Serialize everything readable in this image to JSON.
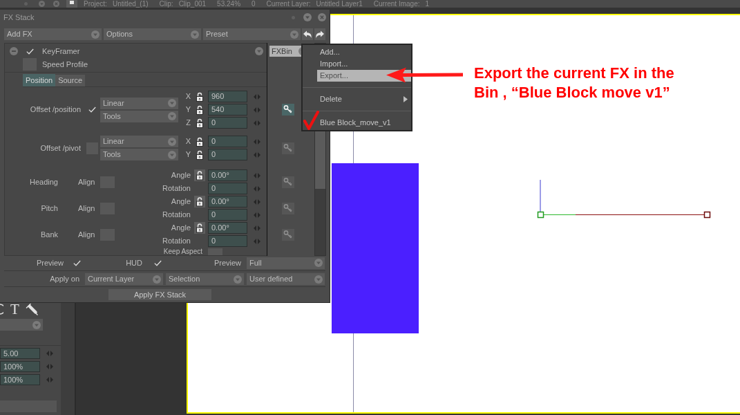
{
  "top_bar": {
    "items": [
      {
        "label": "Project:",
        "value": "Untitled_(1)"
      },
      {
        "label": "Clip:",
        "value": "Clip_001"
      },
      {
        "value": "53.24%"
      },
      {
        "value": "0"
      },
      {
        "label": "Current Layer:",
        "value": "Untitled Layer1"
      },
      {
        "label": "Current Image:",
        "value": "1"
      }
    ]
  },
  "tool_panel": {
    "glyph": "T",
    "fields": [
      "5.00",
      "100%",
      "100%"
    ]
  },
  "fx_stack": {
    "title": "FX Stack",
    "toolbar": [
      "Add FX",
      "Options",
      "Preset"
    ],
    "effect": {
      "name": "KeyFramer",
      "enabled": true
    },
    "speed_profile": {
      "label": "Speed Profile",
      "checked": false
    },
    "tabs": [
      {
        "label": "Position",
        "selected": true
      },
      {
        "label": "Source",
        "selected": false
      }
    ],
    "offsets": [
      {
        "label": "Offset /position",
        "checked": true,
        "interpolation": "Linear",
        "mode": "Tools",
        "key_active": true,
        "axes": [
          {
            "axis": "X",
            "locked": false,
            "value": "960"
          },
          {
            "axis": "Y",
            "locked": false,
            "value": "540"
          },
          {
            "axis": "Z",
            "locked": false,
            "value": "0"
          }
        ]
      },
      {
        "label": "Offset /pivot",
        "checked": false,
        "interpolation": "Linear",
        "mode": "Tools",
        "key_active": false,
        "axes": [
          {
            "axis": "X",
            "locked": false,
            "value": "0"
          },
          {
            "axis": "Y",
            "locked": false,
            "value": "0"
          }
        ]
      }
    ],
    "rotations": [
      {
        "label": "Heading",
        "align_label": "Align",
        "align_checked": false,
        "angle_label": "Angle",
        "angle_locked": false,
        "angle": "0.00°",
        "rotation_label": "Rotation",
        "rotation": "0",
        "key_active": false
      },
      {
        "label": "Pitch",
        "align_label": "Align",
        "align_checked": false,
        "angle_label": "Angle",
        "angle_locked": false,
        "angle": "0.00°",
        "rotation_label": "Rotation",
        "rotation": "0",
        "key_active": false
      },
      {
        "label": "Bank",
        "align_label": "Align",
        "align_checked": false,
        "angle_label": "Angle",
        "angle_locked": false,
        "angle": "0.00°",
        "rotation_label": "Rotation",
        "rotation": "0",
        "key_active": false
      }
    ],
    "keep_aspect": {
      "label": "Keep Aspect",
      "checked": false
    },
    "fxbin": "FXBin",
    "preview": {
      "label": "Preview",
      "checked": true
    },
    "hud": {
      "label": "HUD",
      "checked": true
    },
    "preview_mode": {
      "label": "Preview",
      "value": "Full"
    },
    "apply_on": {
      "label": "Apply on",
      "options": [
        "Current Layer",
        "Selection",
        "User defined"
      ]
    },
    "apply_button": "Apply FX Stack"
  },
  "fxbin_menu": {
    "groups": [
      [
        {
          "kind": "action",
          "label": "Add...",
          "selected": false
        },
        {
          "kind": "action",
          "label": "Import...",
          "selected": false
        },
        {
          "kind": "action",
          "label": "Export...",
          "selected": true
        }
      ],
      [
        {
          "kind": "submenu",
          "label": "Delete",
          "selected": false
        }
      ],
      [
        {
          "kind": "entry",
          "label": "Blue Block_move_v1",
          "selected": false
        }
      ]
    ]
  },
  "annotation": {
    "text": "Export the current FX in the Bin , “Blue Block move v1”"
  }
}
